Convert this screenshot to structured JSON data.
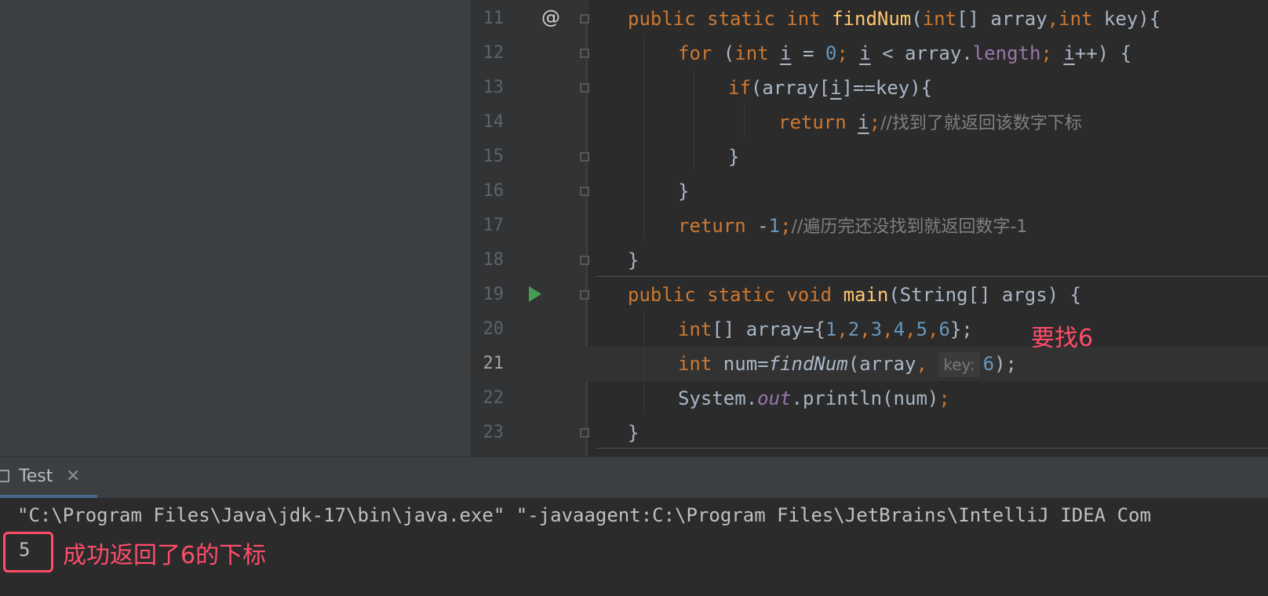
{
  "editor": {
    "lines": [
      {
        "num": "11",
        "p": [
          "public ",
          "static ",
          "int ",
          "findNum",
          "(",
          "int",
          "[] array",
          ",",
          "int ",
          "key){"
        ]
      },
      {
        "num": "12",
        "p": [
          "for ",
          "(",
          "int ",
          "i",
          " = ",
          "0",
          "; ",
          "i",
          " < array.",
          "length",
          "; ",
          "i",
          "++) {"
        ]
      },
      {
        "num": "13",
        "p": [
          "if",
          "(array[",
          "i",
          "]==key){"
        ]
      },
      {
        "num": "14",
        "p": [
          "return ",
          "i",
          ";",
          "//找到了就返回该数字下标"
        ]
      },
      {
        "num": "15",
        "p": [
          "}"
        ]
      },
      {
        "num": "16",
        "p": [
          "}"
        ]
      },
      {
        "num": "17",
        "p": [
          "return ",
          "-",
          "1",
          ";",
          "//遍历完还没找到就返回数字-1"
        ]
      },
      {
        "num": "18",
        "p": [
          "}"
        ]
      },
      {
        "num": "19",
        "p": [
          "public ",
          "static ",
          "void ",
          "main",
          "(String[] args) {"
        ]
      },
      {
        "num": "20",
        "p": [
          "int",
          "[] array={",
          "1",
          ",",
          "2",
          ",",
          "3",
          ",",
          "4",
          ",",
          "5",
          ",",
          "6",
          "};"
        ]
      },
      {
        "num": "21",
        "p": [
          "int ",
          "num=",
          "findNum",
          "(array",
          ", ",
          "key:",
          "6",
          ");"
        ]
      },
      {
        "num": "22",
        "p": [
          "System.",
          "out",
          ".println(num)",
          ";"
        ]
      },
      {
        "num": "23",
        "p": [
          "}"
        ]
      }
    ]
  },
  "annotations": {
    "find_note": "要找6",
    "result_note": "成功返回了6的下标"
  },
  "run_panel": {
    "tab_label": "Test",
    "close_glyph": "✕",
    "command_line": "\"C:\\Program Files\\Java\\jdk-17\\bin\\java.exe\" \"-javaagent:C:\\Program Files\\JetBrains\\IntelliJ IDEA Com",
    "output": "5"
  },
  "colors": {
    "keyword": "#cc7832",
    "function": "#ffc66d",
    "number": "#6897bb",
    "field": "#9876aa",
    "comment": "#808080",
    "annotation": "#ff4d6a"
  }
}
